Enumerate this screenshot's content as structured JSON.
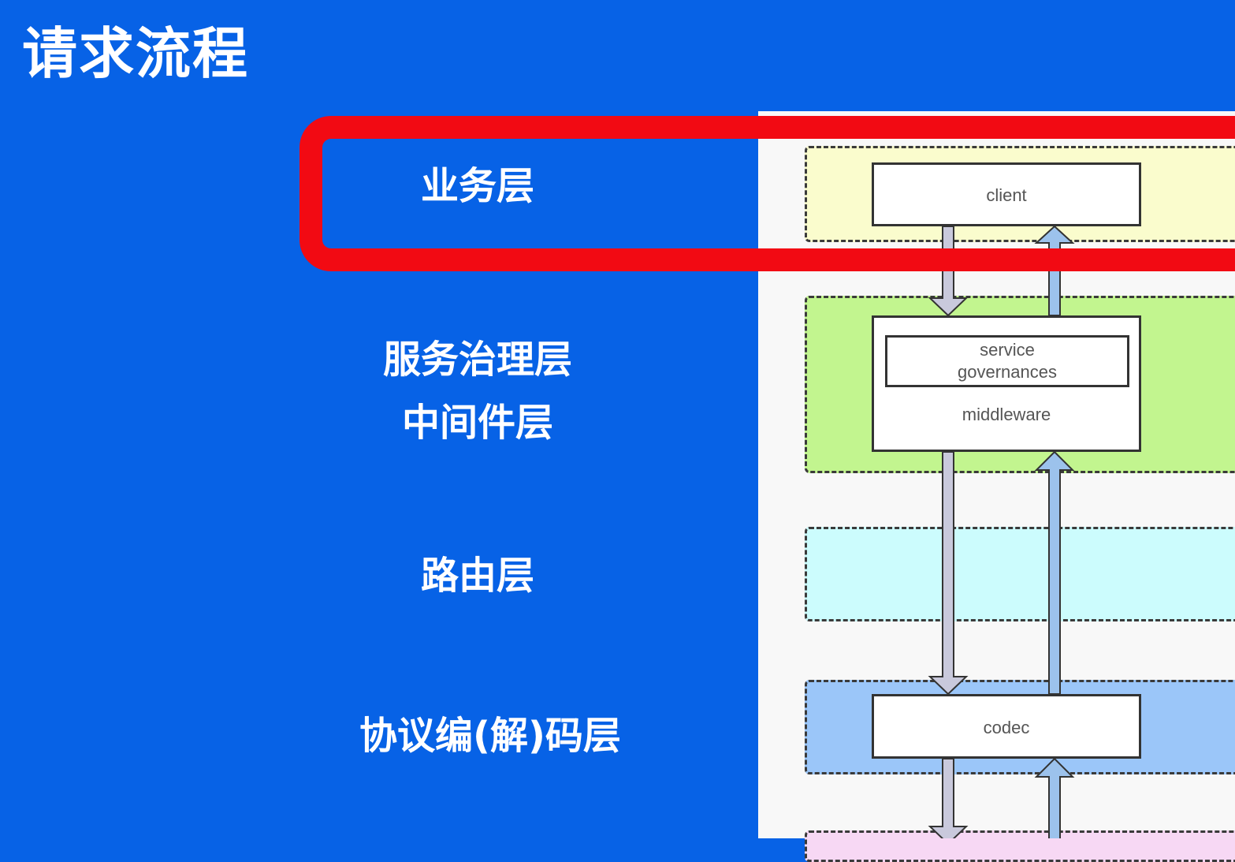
{
  "title": "请求流程",
  "layers": {
    "business": "业务层",
    "governance": "服务治理层",
    "middleware": "中间件层",
    "routing": "路由层",
    "codec": "协议编(解)码层"
  },
  "diagram": {
    "client": "client",
    "service_governances": "service\ngovernances",
    "middleware": "middleware",
    "codec": "codec"
  },
  "colors": {
    "background": "#0762e6",
    "highlight": "#f20a13",
    "zone_business": "#fafccd",
    "zone_governance": "#c2f58f",
    "zone_routing": "#ccfcfd",
    "zone_codec": "#9bc6f9",
    "arrow_down": "#c9c9dc",
    "arrow_up": "#9cc2ec"
  }
}
